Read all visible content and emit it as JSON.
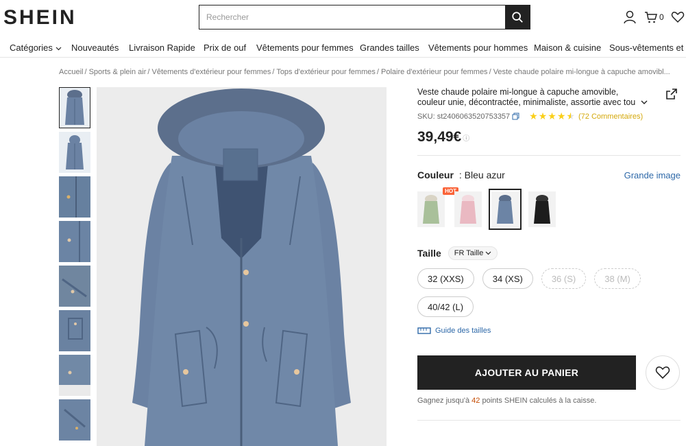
{
  "header": {
    "logo": "SHEIN",
    "search_placeholder": "Rechercher",
    "cart_count": "0"
  },
  "nav": {
    "items": [
      "Catégories",
      "Nouveautés",
      "Livraison Rapide",
      "Prix de ouf",
      "Vêtements pour femmes",
      "Grandes tailles",
      "Vêtements pour hommes",
      "Maison & cuisine",
      "Sous-vêtements et v"
    ]
  },
  "breadcrumb": [
    "Accueil",
    "Sports & plein air",
    "Vêtements d'extérieur pour femmes",
    "Tops d'extérieur pour femmes",
    "Polaire d'extérieur pour femmes",
    "Veste chaude polaire mi-longue à capuche amovibl..."
  ],
  "product": {
    "title": "Veste chaude polaire mi-longue à capuche amovible, couleur unie, décontractée, minimaliste, assortie avec tou",
    "sku": "SKU: st2406063520753357",
    "rating": 4.5,
    "reviews": "(72 Commentaires)",
    "price": "39,49€"
  },
  "color": {
    "label": "Couleur",
    "value": ": Bleu azur",
    "big_image": "Grande image",
    "hot_badge": "HOT",
    "swatches": [
      {
        "name": "vert",
        "hex": "#a9c09a"
      },
      {
        "name": "rose",
        "hex": "#eab9c2"
      },
      {
        "name": "bleu",
        "hex": "#6c84a5"
      },
      {
        "name": "noir",
        "hex": "#1d1d1d"
      }
    ],
    "selected_index": 2
  },
  "size": {
    "label": "Taille",
    "type": "FR Taille",
    "options": [
      {
        "label": "32 (XXS)",
        "available": true
      },
      {
        "label": "34 (XS)",
        "available": true
      },
      {
        "label": "36 (S)",
        "available": false
      },
      {
        "label": "38 (M)",
        "available": false
      },
      {
        "label": "40/42 (L)",
        "available": true
      }
    ],
    "guide": "Guide des tailles"
  },
  "cart": {
    "add_label": "AJOUTER AU PANIER",
    "points_prefix": "Gagnez jusqu'à",
    "points_num": "42",
    "points_suffix": "points SHEIN calculés à la caisse."
  },
  "colors": {
    "coat": "#6b82a3",
    "coat_dark": "#4f6584",
    "fur": "#5c6f8c",
    "accent_link": "#2d68a8",
    "star": "#facf19"
  }
}
